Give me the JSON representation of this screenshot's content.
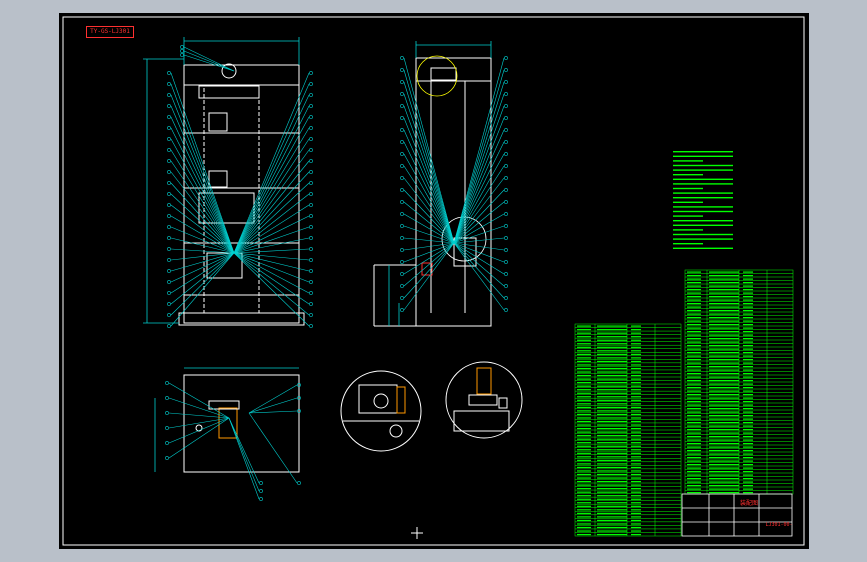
{
  "drawing": {
    "stamp_text": "TY-GS-LJ301",
    "titleblock_name": "装配图",
    "titleblock_code": "LJ301-00-00",
    "center_mark": "+"
  },
  "colors": {
    "frame": "#ffffff",
    "leader": "#00d0d0",
    "notes": "#00ff00",
    "parts_list": "#00ff00",
    "stamp": "#ff3030",
    "object_lines": "#ffffff",
    "dimension": "#00d0d0",
    "background": "#000000",
    "outer": "#b9c0c9"
  },
  "icons": {
    "detail_view_a": "circle-detail-view",
    "detail_view_b": "circle-detail-view"
  }
}
